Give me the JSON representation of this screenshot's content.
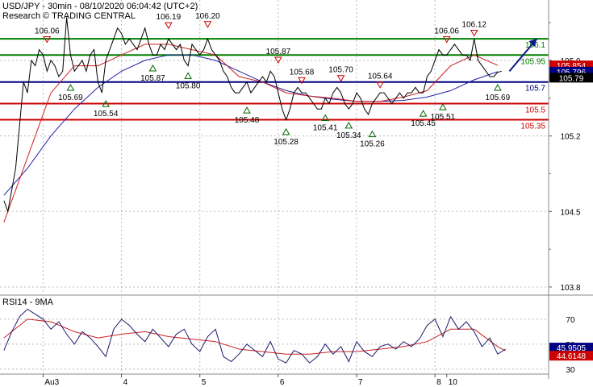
{
  "header": {
    "title": "USD/JPY - 30min - 08/10/2020 06:04:42 (UTC+2)",
    "subtitle": "Research © TRADING CENTRAL"
  },
  "chart_data": [
    {
      "type": "line",
      "title": "USD/JPY - 30min - 08/10/2020 06:04:42 (UTC+2)",
      "y_ticks": [
        "105.9",
        "105.2",
        "104.5",
        "103.8"
      ],
      "x_ticks": [
        "Au3",
        "4",
        "5",
        "6",
        "7",
        "8",
        "10"
      ],
      "ylim": [
        103.74,
        106.46
      ],
      "grid": true,
      "horizontal_levels": [
        {
          "label": "106.1",
          "value": 106.1,
          "color": "#008000"
        },
        {
          "label": "105.95",
          "value": 105.95,
          "color": "#008000"
        },
        {
          "label": "105.7",
          "value": 105.7,
          "color": "#000080"
        },
        {
          "label": "105.5",
          "value": 105.5,
          "color": "#cc0000"
        },
        {
          "label": "105.35",
          "value": 105.35,
          "color": "#cc0000"
        }
      ],
      "price_tags": [
        {
          "label": "105.854",
          "value": 105.854,
          "color": "#cc0000"
        },
        {
          "label": "105.796",
          "value": 105.796,
          "color": "#000080"
        },
        {
          "label": "105.79",
          "value": 105.74,
          "color": "#000000"
        }
      ],
      "pivot_labels": [
        {
          "label": "106.06",
          "x": 0.55,
          "value": 106.06,
          "kind": "high"
        },
        {
          "label": "106.19",
          "x": 2.1,
          "value": 106.19,
          "kind": "high"
        },
        {
          "label": "106.20",
          "x": 2.6,
          "value": 106.2,
          "kind": "high"
        },
        {
          "label": "105.87",
          "x": 3.5,
          "value": 105.87,
          "kind": "high"
        },
        {
          "label": "105.68",
          "x": 3.8,
          "value": 105.68,
          "kind": "high"
        },
        {
          "label": "105.70",
          "x": 4.3,
          "value": 105.7,
          "kind": "high"
        },
        {
          "label": "105.64",
          "x": 4.8,
          "value": 105.64,
          "kind": "high"
        },
        {
          "label": "106.06",
          "x": 5.65,
          "value": 106.06,
          "kind": "high"
        },
        {
          "label": "106.12",
          "x": 6.0,
          "value": 106.12,
          "kind": "high"
        },
        {
          "label": "105.69",
          "x": 0.85,
          "value": 105.69,
          "kind": "low"
        },
        {
          "label": "105.54",
          "x": 1.3,
          "value": 105.54,
          "kind": "low"
        },
        {
          "label": "105.87",
          "x": 1.9,
          "value": 105.87,
          "kind": "low"
        },
        {
          "label": "105.80",
          "x": 2.35,
          "value": 105.8,
          "kind": "low"
        },
        {
          "label": "105.48",
          "x": 3.1,
          "value": 105.48,
          "kind": "low"
        },
        {
          "label": "105.28",
          "x": 3.6,
          "value": 105.28,
          "kind": "low"
        },
        {
          "label": "105.41",
          "x": 4.1,
          "value": 105.41,
          "kind": "low"
        },
        {
          "label": "105.34",
          "x": 4.4,
          "value": 105.34,
          "kind": "low"
        },
        {
          "label": "105.26",
          "x": 4.7,
          "value": 105.26,
          "kind": "low"
        },
        {
          "label": "105.45",
          "x": 5.35,
          "value": 105.45,
          "kind": "low"
        },
        {
          "label": "105.51",
          "x": 5.6,
          "value": 105.51,
          "kind": "low"
        },
        {
          "label": "105.69",
          "x": 6.3,
          "value": 105.69,
          "kind": "low"
        }
      ],
      "price_series": {
        "x": [
          0,
          0.05,
          0.1,
          0.15,
          0.2,
          0.25,
          0.3,
          0.35,
          0.4,
          0.45,
          0.5,
          0.55,
          0.6,
          0.65,
          0.7,
          0.75,
          0.8,
          0.85,
          0.9,
          0.95,
          1.0,
          1.05,
          1.1,
          1.15,
          1.2,
          1.25,
          1.3,
          1.35,
          1.4,
          1.45,
          1.5,
          1.55,
          1.6,
          1.65,
          1.7,
          1.75,
          1.8,
          1.85,
          1.9,
          1.95,
          2.0,
          2.05,
          2.1,
          2.15,
          2.2,
          2.25,
          2.3,
          2.35,
          2.4,
          2.45,
          2.5,
          2.55,
          2.6,
          2.65,
          2.7,
          2.75,
          2.8,
          2.85,
          2.9,
          2.95,
          3.0,
          3.05,
          3.1,
          3.15,
          3.2,
          3.25,
          3.3,
          3.35,
          3.4,
          3.45,
          3.5,
          3.55,
          3.6,
          3.65,
          3.7,
          3.75,
          3.8,
          3.85,
          3.9,
          3.95,
          4.0,
          4.05,
          4.1,
          4.15,
          4.2,
          4.25,
          4.3,
          4.35,
          4.4,
          4.45,
          4.5,
          4.55,
          4.6,
          4.65,
          4.7,
          4.75,
          4.8,
          4.85,
          4.9,
          4.95,
          5.0,
          5.05,
          5.1,
          5.15,
          5.2,
          5.25,
          5.3,
          5.35,
          5.4,
          5.45,
          5.5,
          5.55,
          5.6,
          5.65,
          5.7,
          5.75,
          5.8,
          5.85,
          5.9,
          5.95,
          6.0,
          6.05,
          6.1,
          6.15,
          6.2,
          6.25,
          6.3,
          6.35,
          6.4
        ],
        "values": [
          104.6,
          104.5,
          104.7,
          104.9,
          105.3,
          105.7,
          105.6,
          105.9,
          105.85,
          106.0,
          105.95,
          105.8,
          105.9,
          105.85,
          105.75,
          105.8,
          106.3,
          105.95,
          105.8,
          105.85,
          105.9,
          105.8,
          105.95,
          106.0,
          105.7,
          105.6,
          105.9,
          106.0,
          106.1,
          106.2,
          106.15,
          106.05,
          106.1,
          106.05,
          106.0,
          106.1,
          106.2,
          106.05,
          105.95,
          105.95,
          106.05,
          106.0,
          106.1,
          106.05,
          106.0,
          106.05,
          105.9,
          105.85,
          106.05,
          106.0,
          105.95,
          106.0,
          106.1,
          106.0,
          105.95,
          105.9,
          105.8,
          105.75,
          105.65,
          105.6,
          105.6,
          105.65,
          105.7,
          105.6,
          105.65,
          105.7,
          105.75,
          105.7,
          105.8,
          105.75,
          105.6,
          105.45,
          105.35,
          105.45,
          105.6,
          105.65,
          105.6,
          105.6,
          105.55,
          105.5,
          105.45,
          105.45,
          105.55,
          105.5,
          105.6,
          105.65,
          105.6,
          105.5,
          105.45,
          105.5,
          105.6,
          105.55,
          105.45,
          105.4,
          105.5,
          105.55,
          105.6,
          105.6,
          105.55,
          105.5,
          105.55,
          105.6,
          105.55,
          105.6,
          105.6,
          105.65,
          105.6,
          105.6,
          105.75,
          105.8,
          105.9,
          106.0,
          105.95,
          105.95,
          106.0,
          106.05,
          106.0,
          105.95,
          105.95,
          105.9,
          106.1,
          105.9,
          105.85,
          105.8,
          105.75,
          105.75,
          105.79,
          105.8
        ]
      },
      "ma_fast": {
        "x": [
          0,
          0.3,
          0.6,
          0.9,
          1.2,
          1.5,
          1.8,
          2.1,
          2.4,
          2.7,
          3.0,
          3.3,
          3.6,
          3.9,
          4.2,
          4.5,
          4.8,
          5.1,
          5.4,
          5.7,
          6.0,
          6.3
        ],
        "values": [
          104.4,
          105.0,
          105.6,
          105.85,
          105.85,
          105.95,
          106.05,
          106.05,
          106.0,
          105.95,
          105.75,
          105.7,
          105.6,
          105.57,
          105.55,
          105.52,
          105.52,
          105.56,
          105.62,
          105.85,
          105.95,
          105.854
        ]
      },
      "ma_slow": {
        "x": [
          0,
          0.3,
          0.6,
          0.9,
          1.2,
          1.5,
          1.8,
          2.1,
          2.4,
          2.7,
          3.0,
          3.3,
          3.6,
          3.9,
          4.2,
          4.5,
          4.8,
          5.1,
          5.4,
          5.7,
          6.0,
          6.3
        ],
        "values": [
          104.65,
          104.9,
          105.2,
          105.45,
          105.65,
          105.8,
          105.9,
          105.95,
          105.95,
          105.9,
          105.8,
          105.7,
          105.62,
          105.57,
          105.54,
          105.52,
          105.52,
          105.53,
          105.56,
          105.62,
          105.72,
          105.796
        ]
      },
      "forecast_arrow": {
        "from": [
          6.45,
          105.8
        ],
        "to": [
          6.8,
          106.1
        ]
      }
    },
    {
      "type": "line",
      "title": "RSI14 - 9MA",
      "y_ticks": [
        "70",
        "50",
        "30"
      ],
      "ylim": [
        26,
        88
      ],
      "price_tags": [
        {
          "label": "45.9505",
          "value": 45.95,
          "color": "#000080"
        },
        {
          "label": "44.6148",
          "value": 44.61,
          "color": "#cc0000"
        }
      ],
      "rsi": {
        "x": [
          0,
          0.1,
          0.2,
          0.3,
          0.4,
          0.5,
          0.6,
          0.7,
          0.8,
          0.9,
          1.0,
          1.1,
          1.2,
          1.3,
          1.4,
          1.5,
          1.6,
          1.7,
          1.8,
          1.9,
          2.0,
          2.1,
          2.2,
          2.3,
          2.4,
          2.5,
          2.6,
          2.7,
          2.8,
          2.9,
          3.0,
          3.1,
          3.2,
          3.3,
          3.4,
          3.5,
          3.6,
          3.7,
          3.8,
          3.9,
          4.0,
          4.1,
          4.2,
          4.3,
          4.4,
          4.5,
          4.6,
          4.7,
          4.8,
          4.9,
          5.0,
          5.1,
          5.2,
          5.3,
          5.4,
          5.5,
          5.6,
          5.7,
          5.8,
          5.9,
          6.0,
          6.1,
          6.2,
          6.3,
          6.4
        ],
        "values": [
          45,
          60,
          72,
          78,
          74,
          70,
          62,
          68,
          58,
          50,
          60,
          55,
          48,
          40,
          62,
          70,
          65,
          58,
          52,
          62,
          55,
          48,
          58,
          62,
          50,
          44,
          56,
          62,
          40,
          36,
          42,
          50,
          45,
          40,
          52,
          38,
          35,
          45,
          42,
          35,
          40,
          50,
          42,
          48,
          36,
          52,
          44,
          40,
          48,
          50,
          46,
          52,
          48,
          54,
          65,
          70,
          56,
          72,
          62,
          68,
          60,
          48,
          55,
          42,
          46
        ]
      },
      "rsi_ma": {
        "x": [
          0,
          0.3,
          0.6,
          0.9,
          1.2,
          1.5,
          1.8,
          2.1,
          2.4,
          2.7,
          3.0,
          3.3,
          3.6,
          3.9,
          4.2,
          4.5,
          4.8,
          5.1,
          5.4,
          5.7,
          6.0,
          6.3,
          6.4
        ],
        "values": [
          55,
          70,
          68,
          60,
          55,
          58,
          60,
          56,
          54,
          52,
          46,
          44,
          42,
          42,
          44,
          44,
          46,
          48,
          52,
          62,
          62,
          48,
          44.6
        ]
      }
    }
  ]
}
